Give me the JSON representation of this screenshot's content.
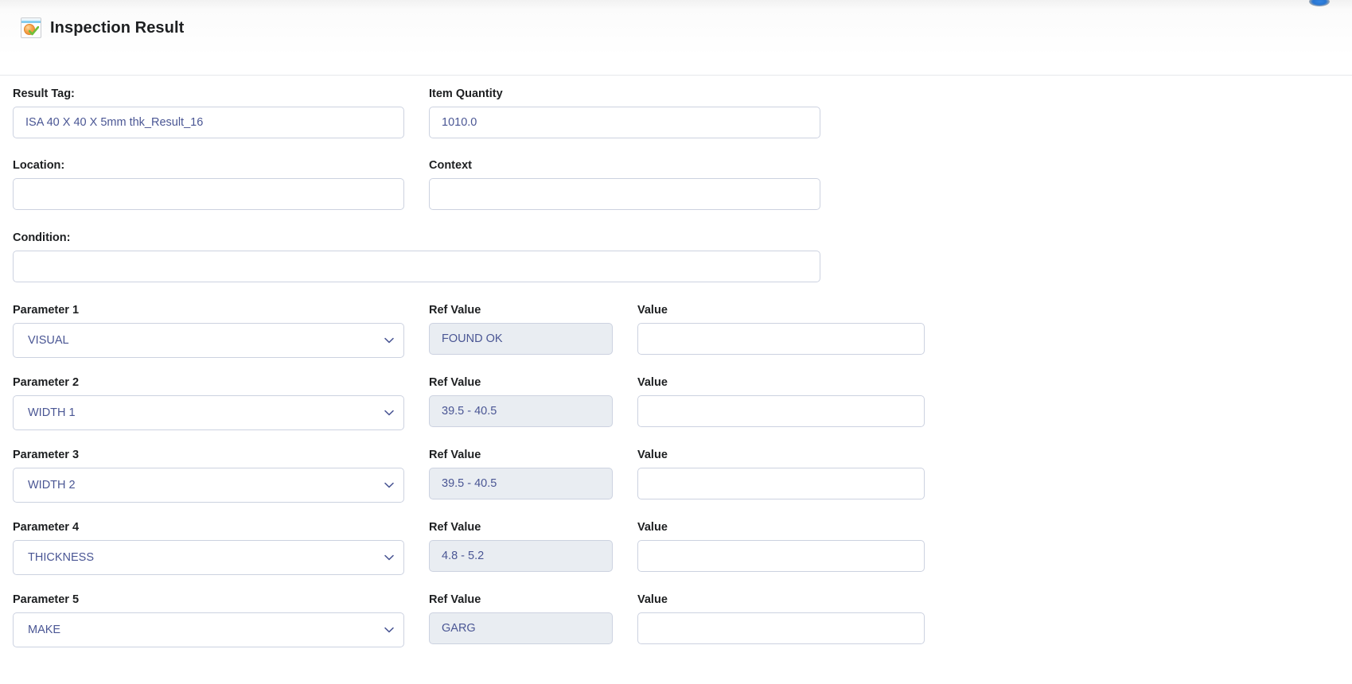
{
  "window": {
    "top_right_icon": "status-indicator-icon"
  },
  "header": {
    "icon": "inspection-result-icon",
    "title": "Inspection Result"
  },
  "form": {
    "result_tag": {
      "label": "Result Tag:",
      "value": "ISA 40 X 40 X 5mm thk_Result_16"
    },
    "item_quantity": {
      "label": "Item Quantity",
      "value": "1010.0"
    },
    "location": {
      "label": "Location:",
      "value": ""
    },
    "context": {
      "label": "Context",
      "value": ""
    },
    "condition": {
      "label": "Condition:",
      "value": ""
    },
    "column_headers": {
      "ref_value": "Ref Value",
      "value": "Value"
    },
    "parameters": [
      {
        "label": "Parameter 1",
        "name": "VISUAL",
        "ref_label": "Ref Value",
        "ref_value": "FOUND OK",
        "value_label": "Value",
        "value": ""
      },
      {
        "label": "Parameter 2",
        "name": "WIDTH 1",
        "ref_label": "Ref Value",
        "ref_value": "39.5 - 40.5",
        "value_label": "Value",
        "value": ""
      },
      {
        "label": "Parameter 3",
        "name": "WIDTH 2",
        "ref_label": "Ref Value",
        "ref_value": "39.5 - 40.5",
        "value_label": "Value",
        "value": ""
      },
      {
        "label": "Parameter 4",
        "name": "THICKNESS",
        "ref_label": "Ref Value",
        "ref_value": "4.8 - 5.2",
        "value_label": "Value",
        "value": ""
      },
      {
        "label": "Parameter 5",
        "name": "MAKE",
        "ref_label": "Ref Value",
        "ref_value": "GARG",
        "value_label": "Value",
        "value": ""
      }
    ]
  },
  "colors": {
    "input_border": "#ccd2e0",
    "input_text": "#4a5694",
    "readonly_bg": "#e9edf2",
    "label_text": "#1d1f21",
    "rule": "#e6e8eb"
  }
}
